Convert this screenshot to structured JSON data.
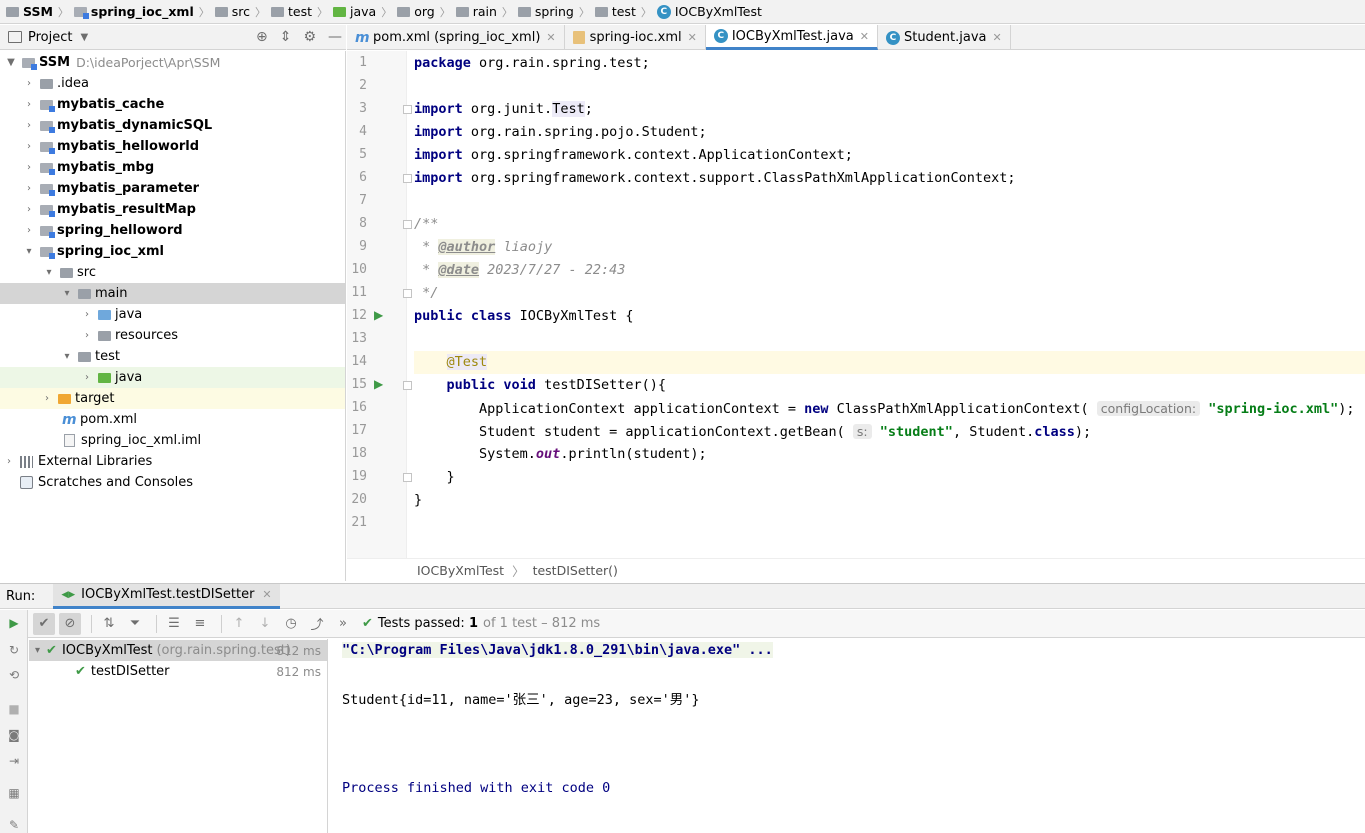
{
  "breadcrumb": [
    "SSM",
    "spring_ioc_xml",
    "src",
    "test",
    "java",
    "org",
    "rain",
    "spring",
    "test",
    "IOCByXmlTest"
  ],
  "project_panel": {
    "title": "Project",
    "tree": [
      {
        "label": "SSM",
        "extra": "D:\\ideaPorject\\Apr\\SSM",
        "bold": true
      },
      {
        "label": ".idea"
      },
      {
        "label": "mybatis_cache",
        "bold": true
      },
      {
        "label": "mybatis_dynamicSQL",
        "bold": true
      },
      {
        "label": "mybatis_helloworld",
        "bold": true
      },
      {
        "label": "mybatis_mbg",
        "bold": true
      },
      {
        "label": "mybatis_parameter",
        "bold": true
      },
      {
        "label": "mybatis_resultMap",
        "bold": true
      },
      {
        "label": "spring_helloword",
        "bold": true
      },
      {
        "label": "spring_ioc_xml",
        "bold": true
      },
      {
        "label": "src"
      },
      {
        "label": "main"
      },
      {
        "label": "java"
      },
      {
        "label": "resources"
      },
      {
        "label": "test"
      },
      {
        "label": "java"
      },
      {
        "label": "target"
      },
      {
        "label": "pom.xml"
      },
      {
        "label": "spring_ioc_xml.iml"
      },
      {
        "label": "External Libraries"
      },
      {
        "label": "Scratches and Consoles"
      }
    ]
  },
  "editor_tabs": [
    {
      "label": "pom.xml (spring_ioc_xml)",
      "icon": "maven-icon"
    },
    {
      "label": "spring-ioc.xml",
      "icon": "xml-icon"
    },
    {
      "label": "IOCByXmlTest.java",
      "icon": "class-icon",
      "active": true
    },
    {
      "label": "Student.java",
      "icon": "class-icon"
    }
  ],
  "code": {
    "line_numbers": [
      "1",
      "2",
      "3",
      "4",
      "5",
      "6",
      "7",
      "8",
      "9",
      "10",
      "11",
      "12",
      "13",
      "14",
      "15",
      "16",
      "17",
      "18",
      "19",
      "20",
      "21"
    ],
    "package_name": "org.rain.spring.test;",
    "imports": [
      "org.junit.",
      "org.rain.spring.pojo.Student;",
      "org.springframework.context.ApplicationContext;",
      "org.springframework.context.support.ClassPathXmlApplicationContext;"
    ],
    "import_test_class": "Test",
    "author": "liaojy",
    "date": "2023/7/27 - 22:43",
    "class_name": "IOCByXmlTest {",
    "method_name": "testDISetter(){",
    "hint_config": "configLocation:",
    "hint_s": "s:",
    "xml_file": "\"spring-ioc.xml\"",
    "bean_name": "\"student\""
  },
  "editor_breadcrumb": [
    "IOCByXmlTest",
    "testDISetter()"
  ],
  "run": {
    "label": "Run:",
    "tab": "IOCByXmlTest.testDISetter",
    "status_prefix": "Tests passed:",
    "status_count": "1",
    "status_detail": "of 1 test – 812 ms",
    "test_tree": [
      {
        "label": "IOCByXmlTest",
        "extra": "(org.rain.spring.test)",
        "time": "812 ms"
      },
      {
        "label": "testDISetter",
        "time": "812 ms"
      }
    ],
    "console": [
      "\"C:\\Program Files\\Java\\jdk1.8.0_291\\bin\\java.exe\" ...",
      "Student{id=11, name='张三', age=23, sex='男'}",
      "Process finished with exit code 0"
    ]
  },
  "colors": {
    "accent": "#4083c9",
    "pass_green": "#3f9a47",
    "keyword": "#000080",
    "string": "#067d17"
  }
}
